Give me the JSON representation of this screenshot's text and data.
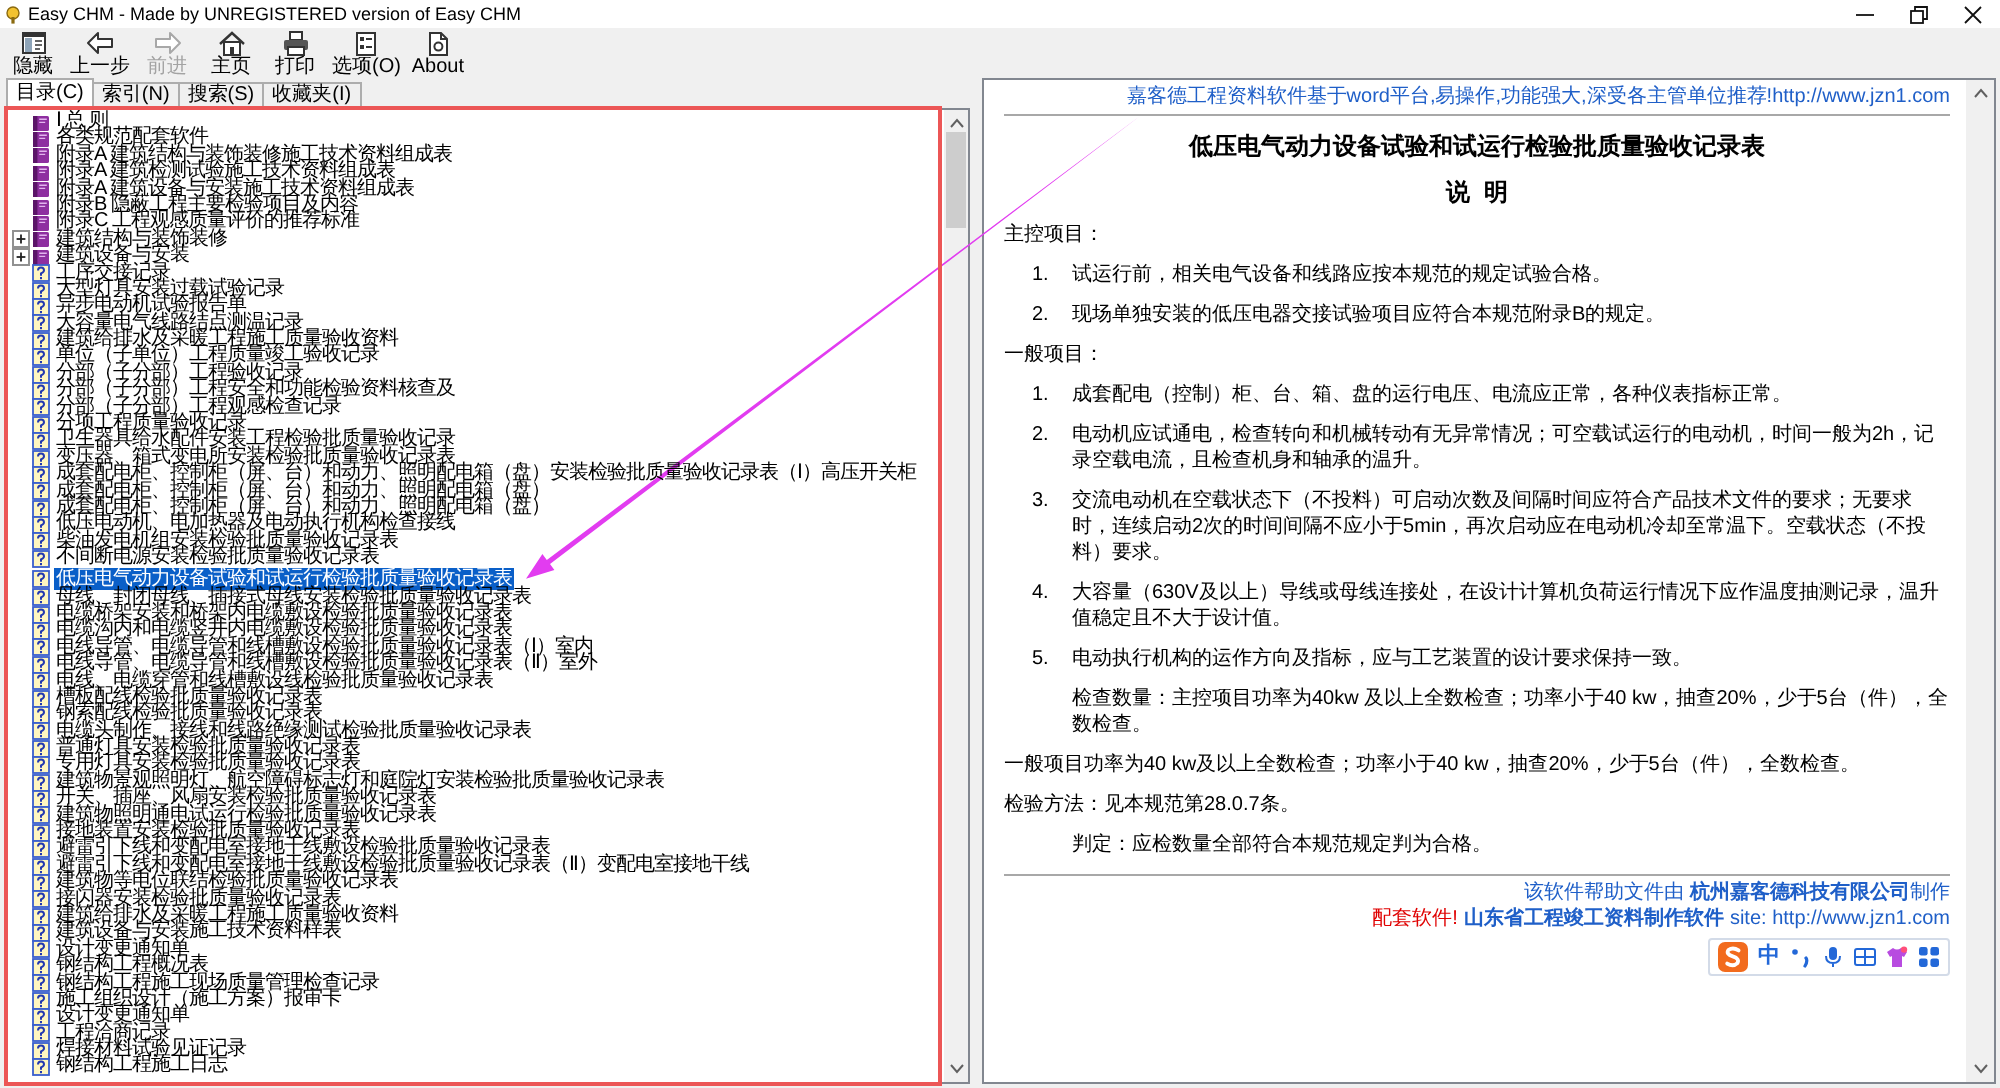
{
  "window": {
    "title": "Easy CHM - Made by UNREGISTERED version of Easy CHM"
  },
  "toolbar": [
    {
      "kind": "hide",
      "label": "隐藏",
      "disabled": false
    },
    {
      "kind": "back",
      "label": "上一步",
      "disabled": false
    },
    {
      "kind": "forward",
      "label": "前进",
      "disabled": true
    },
    {
      "kind": "home",
      "label": "主页",
      "disabled": false
    },
    {
      "kind": "print",
      "label": "打印",
      "disabled": false
    },
    {
      "kind": "options",
      "label": "选项(O)",
      "disabled": false
    },
    {
      "kind": "about",
      "label": "About",
      "disabled": false
    }
  ],
  "tabs": [
    {
      "label": "目录(C)",
      "selected": true
    },
    {
      "label": "索引(N)",
      "selected": false
    },
    {
      "label": "搜索(S)",
      "selected": false
    },
    {
      "label": "收藏夹(I)",
      "selected": false
    }
  ],
  "tree": {
    "items": [
      {
        "kind": "book",
        "label": "Ⅰ 总 则",
        "selected": false
      },
      {
        "kind": "book",
        "label": "各类规范配套软件",
        "selected": false
      },
      {
        "kind": "book",
        "label": "附录A 建筑结构与装饰装修施工技术资料组成表",
        "selected": false
      },
      {
        "kind": "book",
        "label": "附录A 建筑检测试验施工技术资料组成表",
        "selected": false
      },
      {
        "kind": "book",
        "label": "附录A 建筑设备与安装施工技术资料组成表",
        "selected": false
      },
      {
        "kind": "book",
        "label": "附录B 隐蔽工程主要检验项目及内容",
        "selected": false
      },
      {
        "kind": "book",
        "label": "附录C 工程观感质量评价的推荐标准",
        "selected": false
      },
      {
        "kind": "book",
        "label": "建筑结构与装饰装修",
        "selected": false,
        "expanded": false
      },
      {
        "kind": "book",
        "label": "建筑设备与安装",
        "selected": false,
        "expanded": false
      },
      {
        "kind": "page",
        "label": "工序交接记录",
        "selected": false
      },
      {
        "kind": "page",
        "label": "大型灯具安装过载试验记录",
        "selected": false
      },
      {
        "kind": "page",
        "label": "异步电动机试验报告单",
        "selected": false
      },
      {
        "kind": "page",
        "label": "大容量电气线路结点测温记录",
        "selected": false
      },
      {
        "kind": "page",
        "label": "建筑给排水及采暖工程施工质量验收资料",
        "selected": false
      },
      {
        "kind": "page",
        "label": "单位（子单位）工程质量竣工验收记录",
        "selected": false
      },
      {
        "kind": "page",
        "label": "分部（子分部）工程验收记录",
        "selected": false
      },
      {
        "kind": "page",
        "label": "分部（子分部）工程安全和功能检验资料核查及",
        "selected": false
      },
      {
        "kind": "page",
        "label": "分部（子分部）工程观感检查记录",
        "selected": false
      },
      {
        "kind": "page",
        "label": "分项工程质量验收记录",
        "selected": false
      },
      {
        "kind": "page",
        "label": "卫生器具给水配件安装工程检验批质量验收记录",
        "selected": false
      },
      {
        "kind": "page",
        "label": "变压器、箱式变电所安装检验批质量验收记录表",
        "selected": false
      },
      {
        "kind": "page",
        "label": "成套配电柜、控制柜（屏、台）和动力、照明配电箱（盘）安装检验批质量验收记录表（Ⅰ）高压开关柜",
        "selected": false
      },
      {
        "kind": "page",
        "label": "成套配电柜、控制柜（屏、台）和动力、照明配电箱（盘）",
        "selected": false
      },
      {
        "kind": "page",
        "label": "成套配电柜、控制柜（屏、台）和动力、照明配电箱（盘）",
        "selected": false
      },
      {
        "kind": "page",
        "label": "低压电动机、电加热器及电动执行机构检查接线",
        "selected": false
      },
      {
        "kind": "page",
        "label": "柴油发电机组安装检验批质量验收记录表",
        "selected": false
      },
      {
        "kind": "page",
        "label": "不间断电源安装检验批质量验收记录表",
        "selected": false
      },
      {
        "kind": "page",
        "label": "低压电气动力设备试验和试运行检验批质量验收记录表",
        "selected": true
      },
      {
        "kind": "page",
        "label": "母线、封闭母线、插接式母线安装检验批质量验收记录表",
        "selected": false
      },
      {
        "kind": "page",
        "label": "电缆桥架安装和桥架内电缆敷设检验批质量验收记录表",
        "selected": false
      },
      {
        "kind": "page",
        "label": "电缆沟内和电缆竖井内电缆敷设检验批质量验收记录表",
        "selected": false
      },
      {
        "kind": "page",
        "label": "电线导管、电缆导管和线槽敷设检验批质量验收记录表（Ⅰ）室内",
        "selected": false
      },
      {
        "kind": "page",
        "label": "电线导管、电缆导管和线槽敷设检验批质量验收记录表（Ⅱ）室外",
        "selected": false
      },
      {
        "kind": "page",
        "label": "电线、电缆穿管和线槽敷设线检验批质量验收记录表",
        "selected": false
      },
      {
        "kind": "page",
        "label": "槽板配线检验批质量验收记录表",
        "selected": false
      },
      {
        "kind": "page",
        "label": "钢索配线检验批质量验收记录表",
        "selected": false
      },
      {
        "kind": "page",
        "label": "电缆头制作、接线和线路绝缘测试检验批质量验收记录表",
        "selected": false
      },
      {
        "kind": "page",
        "label": "普通灯具安装检验批质量验收记录表",
        "selected": false
      },
      {
        "kind": "page",
        "label": "专用灯具安装检验批质量验收记录表",
        "selected": false
      },
      {
        "kind": "page",
        "label": "建筑物景观照明灯、航空障碍标志灯和庭院灯安装检验批质量验收记录表",
        "selected": false
      },
      {
        "kind": "page",
        "label": "开关、插座、风扇安装检验批质量验收记录表",
        "selected": false
      },
      {
        "kind": "page",
        "label": "建筑物照明通电试运行检验批质量验收记录表",
        "selected": false
      },
      {
        "kind": "page",
        "label": "接地装置安装检验批质量验收记录表",
        "selected": false
      },
      {
        "kind": "page",
        "label": "避雷引下线和变配电室接地干线敷设检验批质量验收记录表",
        "selected": false
      },
      {
        "kind": "page",
        "label": "避雷引下线和变配电室接地干线敷设检验批质量验收记录表（Ⅱ）变配电室接地干线",
        "selected": false
      },
      {
        "kind": "page",
        "label": "建筑物等电位联结检验批质量验收记录表",
        "selected": false
      },
      {
        "kind": "page",
        "label": "接闪器安装检验批质量验收记录表",
        "selected": false
      },
      {
        "kind": "page",
        "label": "建筑给排水及采暖工程施工质量验收资料",
        "selected": false
      },
      {
        "kind": "page",
        "label": "建筑设备与安装施工技术资料样表",
        "selected": false
      },
      {
        "kind": "page",
        "label": "设计变更通知单",
        "selected": false
      },
      {
        "kind": "page",
        "label": "钢结构工程概况表",
        "selected": false
      },
      {
        "kind": "page",
        "label": "钢结构工程施工现场质量管理检查记录",
        "selected": false
      },
      {
        "kind": "page",
        "label": "施工组织设计（施工方案）报审卡",
        "selected": false
      },
      {
        "kind": "page",
        "label": "设计变更通知单",
        "selected": false
      },
      {
        "kind": "page",
        "label": "工程洽商记录",
        "selected": false
      },
      {
        "kind": "page",
        "label": "焊接材料试验见证记录",
        "selected": false
      },
      {
        "kind": "page",
        "label": "钢结构工程施工日志",
        "selected": false
      }
    ]
  },
  "document": {
    "top_link": "嘉客德工程资料软件基于word平台,易操作,功能强大,深受各主管单位推荐!http://www.jzn1.com",
    "title": "低压电气动力设备试验和试运行检验批质量验收记录表",
    "subtitle": "说  明",
    "blocks": [
      {
        "kind": "heading",
        "text": "主控项目："
      },
      {
        "kind": "item",
        "number": "1.",
        "text": "试运行前，相关电气设备和线路应按本规范的规定试验合格。"
      },
      {
        "kind": "item",
        "number": "2.",
        "text": "现场单独安装的低压电器交接试验项目应符合本规范附录B的规定。"
      },
      {
        "kind": "heading",
        "text": "一般项目："
      },
      {
        "kind": "item",
        "number": "1.",
        "text": "成套配电（控制）柜、台、箱、盘的运行电压、电流应正常，各种仪表指标正常。"
      },
      {
        "kind": "item",
        "number": "2.",
        "text": "电动机应试通电，检查转向和机械转动有无异常情况；可空载试运行的电动机，时间一般为2h，记录空载电流，且检查机身和轴承的温升。"
      },
      {
        "kind": "item",
        "number": "3.",
        "text": "交流电动机在空载状态下（不投料）可启动次数及间隔时间应符合产品技术文件的要求；无要求时，连续启动2次的时间间隔不应小于5min，再次启动应在电动机冷却至常温下。空载状态（不投料）要求。"
      },
      {
        "kind": "item",
        "number": "4.",
        "text": "大容量（630V及以上）导线或母线连接处，在设计计算机负荷运行情况下应作温度抽测记录，温升值稳定且不大于设计值。"
      },
      {
        "kind": "item",
        "number": "5.",
        "text": "电动执行机构的运作方向及指标，应与工艺装置的设计要求保持一致。"
      },
      {
        "kind": "indented",
        "text": "检查数量：主控项目功率为40kw 及以上全数检查；功率小于40 kw，抽查20%，少于5台（件），全数检查。"
      },
      {
        "kind": "plain",
        "text": "一般项目功率为40 kw及以上全数检查；功率小于40 kw，抽查20%，少于5台（件），全数检查。"
      },
      {
        "kind": "plain",
        "text": "检验方法：见本规范第28.0.7条。"
      },
      {
        "kind": "indented",
        "text": "判定：应检数量全部符合本规范规定判为合格。"
      }
    ],
    "footer": {
      "credit": "该软件帮助文件由 **杭州嘉客德科技有限公司**制作",
      "links": [
        {
          "kind": "note",
          "text": "配套软件!"
        },
        {
          "kind": "product",
          "text": "山东省工程竣工资料制作软件"
        },
        {
          "kind": "site",
          "text": "site: http://www.jzn1.com"
        }
      ]
    }
  },
  "ime_toolbar": {
    "mode": "中"
  },
  "annotations": {
    "highlight_frame": true,
    "pointer_arrow": true
  }
}
